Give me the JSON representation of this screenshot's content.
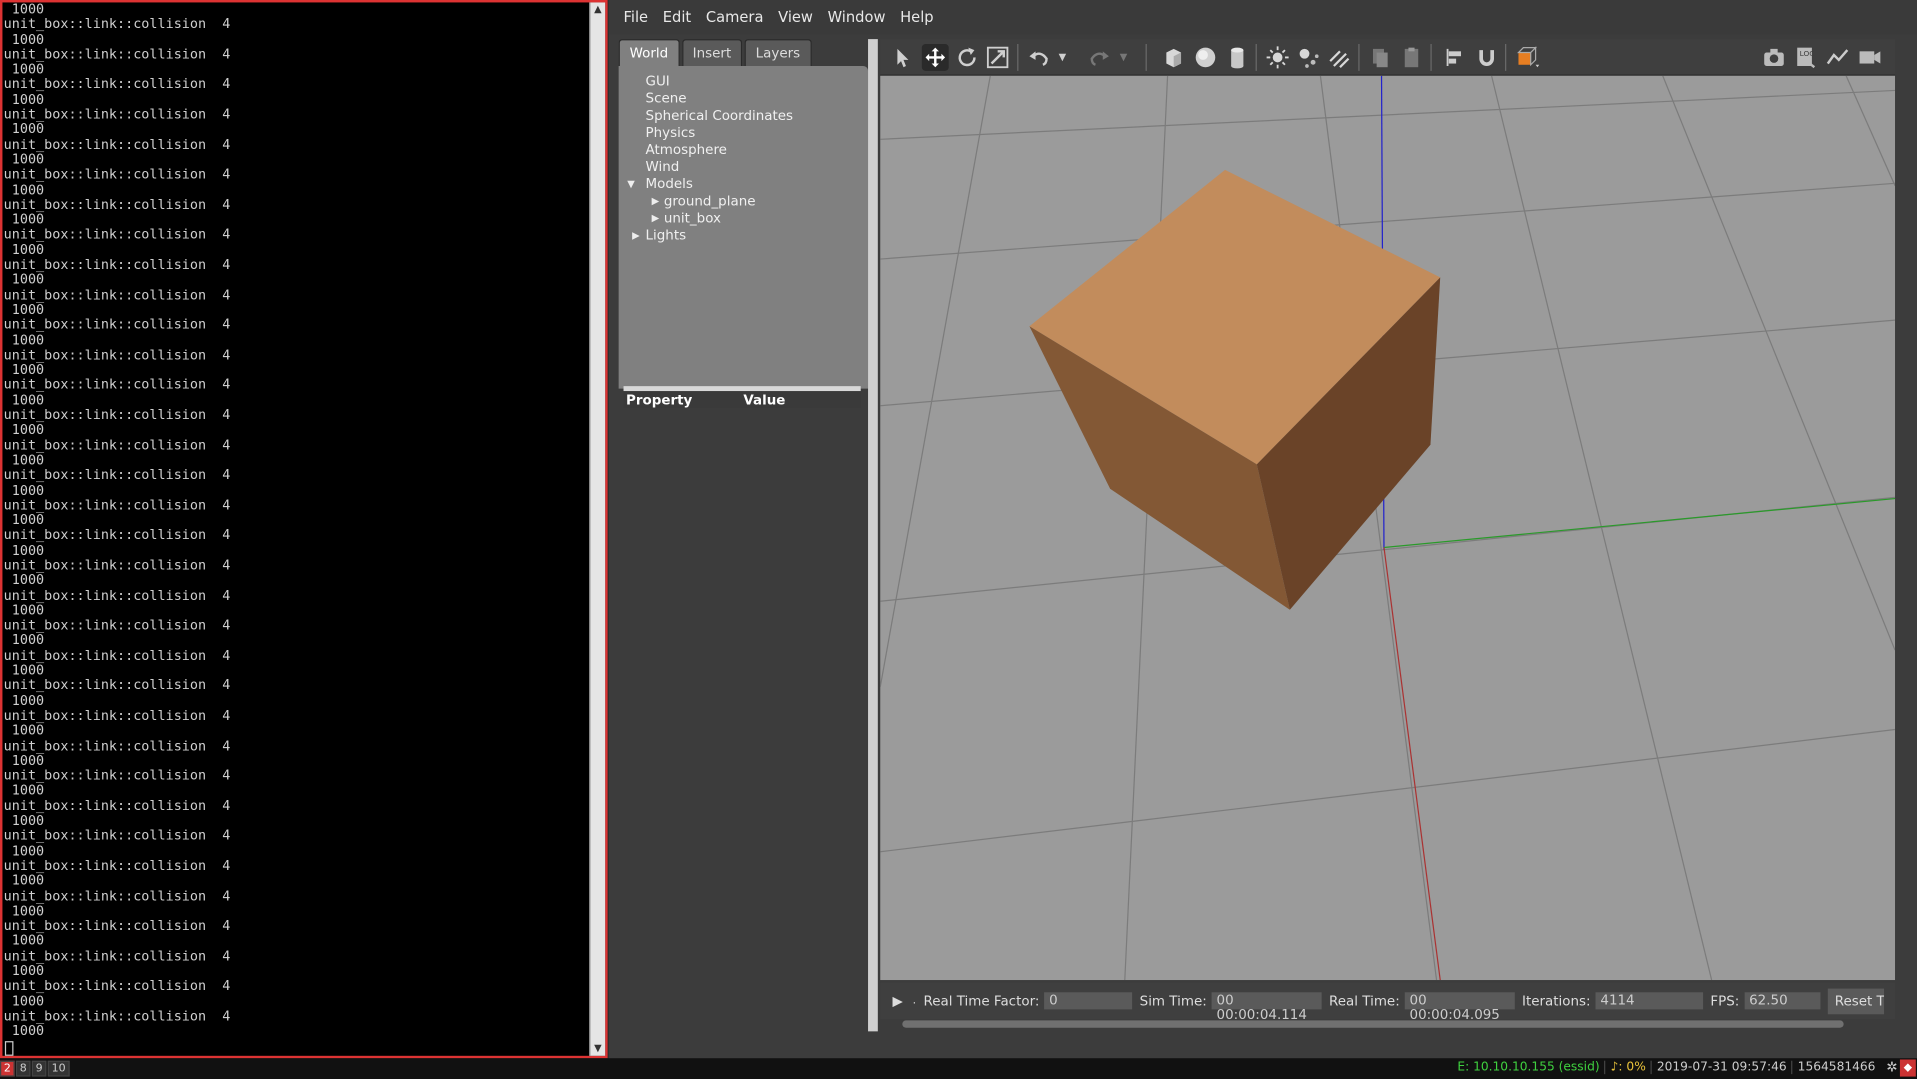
{
  "terminal": {
    "first_line": " 1000",
    "repeat_line_a": "unit_box::link::collision  4",
    "repeat_line_b": " 1000",
    "repeat_count": 34
  },
  "menubar": [
    "File",
    "Edit",
    "Camera",
    "View",
    "Window",
    "Help"
  ],
  "left_tabs": [
    "World",
    "Insert",
    "Layers"
  ],
  "tree": {
    "gui": "GUI",
    "scene": "Scene",
    "spherical": "Spherical Coordinates",
    "physics": "Physics",
    "atmosphere": "Atmosphere",
    "wind": "Wind",
    "models": "Models",
    "ground_plane": "ground_plane",
    "unit_box": "unit_box",
    "lights": "Lights"
  },
  "properties": {
    "col_property": "Property",
    "col_value": "Value"
  },
  "toolbar_icons": [
    "select-icon",
    "translate-icon",
    "rotate-icon",
    "scale-icon",
    "undo-icon",
    "undo-dropdown-icon",
    "redo-icon",
    "redo-dropdown-icon",
    "box-icon",
    "sphere-icon",
    "cylinder-icon",
    "point-light-icon",
    "spot-light-icon",
    "directional-light-icon",
    "copy-icon",
    "paste-icon",
    "align-icon",
    "snap-icon",
    "view-angle-icon",
    "screenshot-icon",
    "log-icon",
    "plot-icon",
    "record-icon"
  ],
  "simbar": {
    "rtf_label": "Real Time Factor:",
    "rtf_value": "0",
    "sim_time_label": "Sim Time:",
    "sim_time_value": "00 00:00:04.114",
    "real_time_label": "Real Time:",
    "real_time_value": "00 00:00:04.095",
    "iter_label": "Iterations:",
    "iter_value": "4114",
    "fps_label": "FPS:",
    "fps_value": "62.50",
    "reset_label": "Reset T"
  },
  "taskbar": {
    "workspaces": [
      "2",
      "8",
      "9",
      "10"
    ],
    "network": "E: 10.10.10.155 (essid)",
    "volume": "♪: 0%",
    "datetime": "2019-07-31 09:57:46",
    "epoch": "1564581466"
  },
  "colors": {
    "box_top": "#c28c5c",
    "box_left": "#835835",
    "box_right": "#6a4328",
    "ground": "#9a9a9a",
    "terminal_border": "#dd3333"
  }
}
